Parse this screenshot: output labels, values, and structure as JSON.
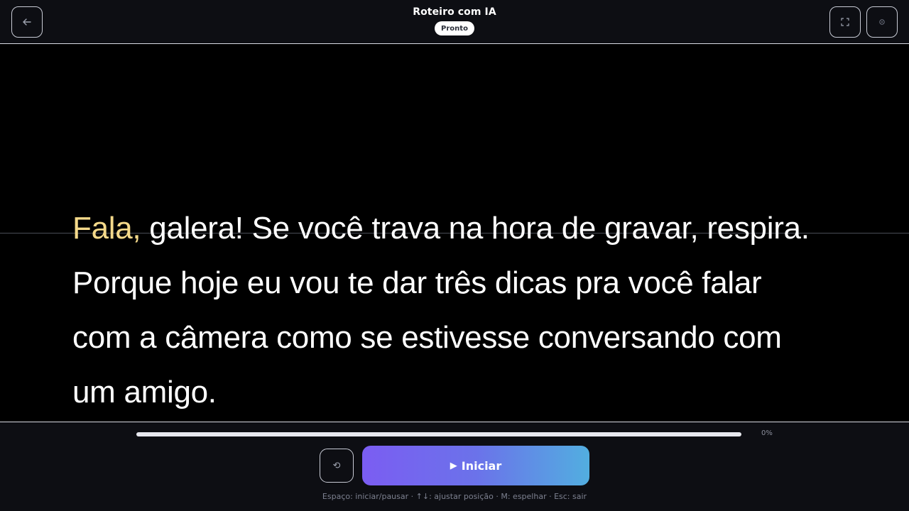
{
  "header": {
    "title": "Roteiro com IA",
    "status": "Pronto",
    "back_icon": "arrow-left-icon",
    "fullscreen_icon": "fullscreen-icon",
    "settings_icon": "gear-icon"
  },
  "script": {
    "highlight": "Fala,",
    "line1_rest": " galera! Se você trava na hora de gravar, respira.",
    "line2": "Porque hoje eu vou te dar três dicas pra você falar",
    "line3": "com a câmera como se estivesse conversando com",
    "line4": "um amigo."
  },
  "controls": {
    "progress_percent": 0,
    "progress_label": "0%",
    "reset_icon": "reset-icon",
    "reset_glyph": "⟲",
    "play_glyph": "▶",
    "start_label": "Iniciar",
    "shortcuts": "Espaço: iniciar/pausar · ↑↓: ajustar posição · M: espelhar · Esc: sair"
  },
  "colors": {
    "highlight": "#f4d98a",
    "accent_start": "#7b5df2",
    "accent_end": "#52aee0",
    "background": "#000000"
  }
}
